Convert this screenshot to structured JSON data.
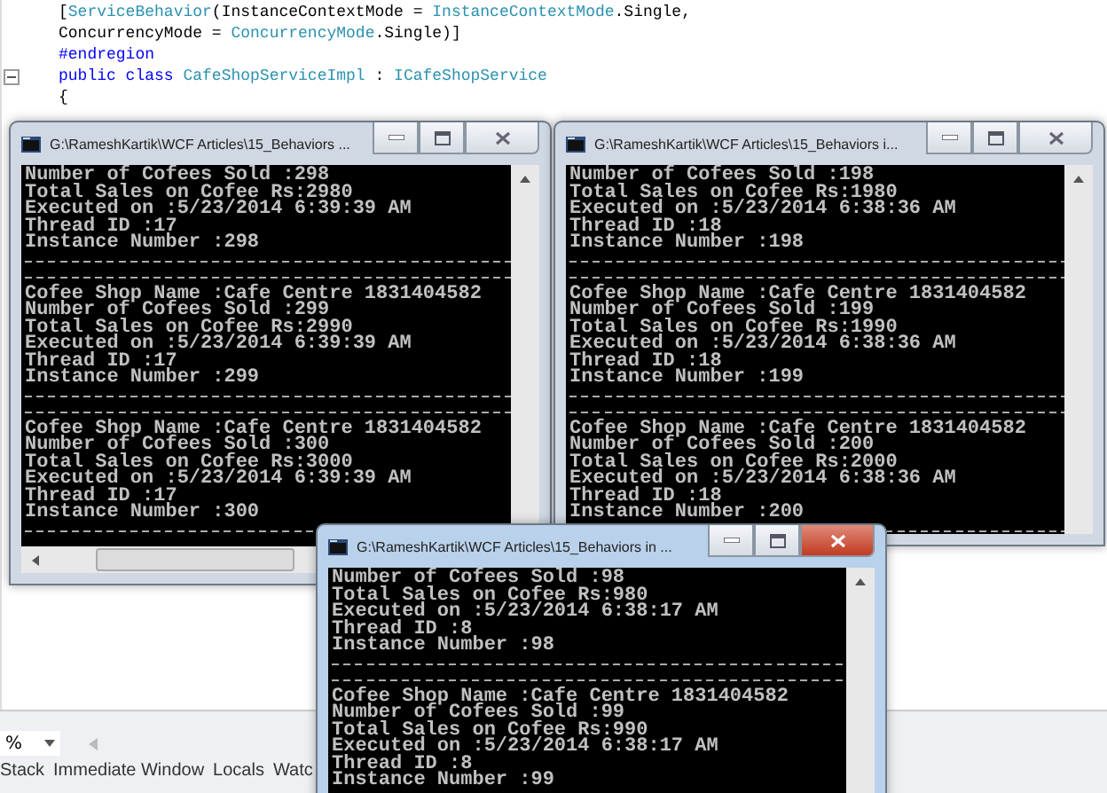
{
  "editor": {
    "lines": [
      [
        {
          "text": "[",
          "kind": "plain"
        },
        {
          "text": "ServiceBehavior",
          "kind": "type"
        },
        {
          "text": "(InstanceContextMode = ",
          "kind": "plain"
        },
        {
          "text": "InstanceContextMode",
          "kind": "type"
        },
        {
          "text": ".Single,",
          "kind": "plain"
        }
      ],
      [
        {
          "text": "ConcurrencyMode = ",
          "kind": "plain"
        },
        {
          "text": "ConcurrencyMode",
          "kind": "type"
        },
        {
          "text": ".Single)]",
          "kind": "plain"
        }
      ],
      [
        {
          "text": "#endregion",
          "kind": "keyword"
        }
      ],
      [
        {
          "text": "public class ",
          "kind": "keyword"
        },
        {
          "text": "CafeShopServiceImpl",
          "kind": "type"
        },
        {
          "text": " : ",
          "kind": "plain"
        },
        {
          "text": "ICafeShopService",
          "kind": "type"
        }
      ],
      [
        {
          "text": "{",
          "kind": "plain"
        }
      ]
    ]
  },
  "consoles": [
    {
      "title": "G:\\RameshKartik\\WCF Articles\\15_Behaviors ...",
      "active": false,
      "records": [
        [
          "Number of Cofees Sold :298",
          "Total Sales on Cofee Rs:2980",
          "Executed on :5/23/2014 6:39:39 AM",
          "Thread ID :17",
          "Instance Number :298"
        ],
        [
          "Cofee Shop Name :Cafe Centre 1831404582",
          "Number of Cofees Sold :299",
          "Total Sales on Cofee Rs:2990",
          "Executed on :5/23/2014 6:39:39 AM",
          "Thread ID :17",
          "Instance Number :299"
        ],
        [
          "Cofee Shop Name :Cafe Centre 1831404582",
          "Number of Cofees Sold :300",
          "Total Sales on Cofee Rs:3000",
          "Executed on :5/23/2014 6:39:39 AM",
          "Thread ID :17",
          "Instance Number :300"
        ]
      ]
    },
    {
      "title": "G:\\RameshKartik\\WCF Articles\\15_Behaviors i...",
      "active": false,
      "records": [
        [
          "Number of Cofees Sold :198",
          "Total Sales on Cofee Rs:1980",
          "Executed on :5/23/2014 6:38:36 AM",
          "Thread ID :18",
          "Instance Number :198"
        ],
        [
          "Cofee Shop Name :Cafe Centre 1831404582",
          "Number of Cofees Sold :199",
          "Total Sales on Cofee Rs:1990",
          "Executed on :5/23/2014 6:38:36 AM",
          "Thread ID :18",
          "Instance Number :199"
        ],
        [
          "Cofee Shop Name :Cafe Centre 1831404582",
          "Number of Cofees Sold :200",
          "Total Sales on Cofee Rs:2000",
          "Executed on :5/23/2014 6:38:36 AM",
          "Thread ID :18",
          "Instance Number :200"
        ]
      ]
    },
    {
      "title": "G:\\RameshKartik\\WCF Articles\\15_Behaviors in ...",
      "active": true,
      "records": [
        [
          "Number of Cofees Sold :98",
          "Total Sales on Cofee Rs:980",
          "Executed on :5/23/2014 6:38:17 AM",
          "Thread ID :8",
          "Instance Number :98"
        ],
        [
          "Cofee Shop Name :Cafe Centre 1831404582",
          "Number of Cofees Sold :99",
          "Total Sales on Cofee Rs:990",
          "Executed on :5/23/2014 6:38:17 AM",
          "Thread ID :8",
          "Instance Number :99"
        ]
      ]
    }
  ],
  "zoom": {
    "value": "%"
  },
  "bottom_tabs": [
    "Stack",
    "Immediate Window",
    "Locals",
    "Watc"
  ]
}
